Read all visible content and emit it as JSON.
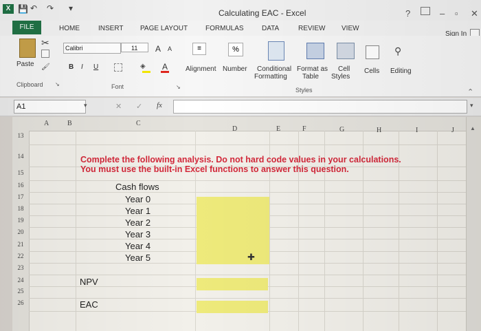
{
  "window": {
    "title": "Calculating EAC - Excel",
    "help": "?",
    "minimize": "–",
    "restore": "▫",
    "close": "✕",
    "sign_in": "Sign In"
  },
  "tabs": [
    "FILE",
    "HOME",
    "INSERT",
    "PAGE LAYOUT",
    "FORMULAS",
    "DATA",
    "REVIEW",
    "VIEW"
  ],
  "ribbon": {
    "paste": "Paste",
    "clipboard": "Clipboard",
    "font_name": "Calibri",
    "font_size": "11",
    "grow_font": "A",
    "shrink_font": "A",
    "bold": "B",
    "italic": "I",
    "underline": "U",
    "font_group": "Font",
    "alignment": "Alignment",
    "number": "Number",
    "number_icon": "%",
    "conditional_formatting_line1": "Conditional",
    "conditional_formatting_line2": "Formatting",
    "format_as_table_line1": "Format as",
    "format_as_table_line2": "Table",
    "cell_styles_line1": "Cell",
    "cell_styles_line2": "Styles",
    "styles_group": "Styles",
    "cells": "Cells",
    "editing": "Editing"
  },
  "formula_bar": {
    "name_box": "A1",
    "fx": "fx",
    "cancel": "✕",
    "enter": "✓",
    "value": ""
  },
  "columns": [
    "A",
    "B",
    "C",
    "D",
    "E",
    "F",
    "G",
    "H",
    "I",
    "J"
  ],
  "rows": [
    "13",
    "14",
    "15",
    "16",
    "17",
    "18",
    "19",
    "20",
    "21",
    "22",
    "23",
    "24",
    "25",
    "26"
  ],
  "sheet": {
    "instruction_line1": "Complete the following analysis. Do not hard code values in your calculations.",
    "instruction_line2": "You must use the built-in Excel functions to answer this question.",
    "cash_flows_header": "Cash flows",
    "years": [
      "Year 0",
      "Year 1",
      "Year 2",
      "Year 3",
      "Year 4",
      "Year 5"
    ],
    "npv_label": "NPV",
    "eac_label": "EAC"
  },
  "colors": {
    "input_fill": "#eeea7b",
    "instruction_text": "#d3283a",
    "excel_green": "#217346"
  }
}
